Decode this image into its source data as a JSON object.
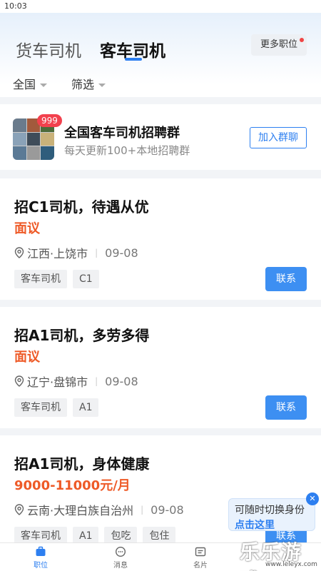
{
  "status_bar": {
    "time": "10:03"
  },
  "header": {
    "tabs": [
      "货车司机",
      "客车司机"
    ],
    "more_jobs": "更多职位",
    "filters": [
      "全国",
      "筛选"
    ]
  },
  "group": {
    "badge": "999",
    "title": "全国客车司机招聘群",
    "subtitle": "每天更新100+本地招聘群",
    "join": "加入群聊"
  },
  "jobs": [
    {
      "title": "招C1司机，待遇从优",
      "salary": "面议",
      "location": "江西·上饶市",
      "date": "09-08",
      "tags": [
        "客车司机",
        "C1"
      ],
      "contact": "联系"
    },
    {
      "title": "招A1司机，多劳多得",
      "salary": "面议",
      "location": "辽宁·盘锦市",
      "date": "09-08",
      "tags": [
        "客车司机",
        "A1"
      ],
      "contact": "联系"
    },
    {
      "title": "招A1司机，身体健康",
      "salary": "9000-11000元/月",
      "location": "云南·大理白族自治州",
      "date": "09-08",
      "tags": [
        "客车司机",
        "A1",
        "包吃",
        "包住"
      ],
      "contact": "联系"
    }
  ],
  "switch_tip": {
    "line1": "可随时切换身份",
    "line2": "点击这里",
    "close": "✕"
  },
  "bottom_nav": [
    {
      "label": "职位",
      "icon": "briefcase-icon"
    },
    {
      "label": "消息",
      "icon": "chat-icon"
    },
    {
      "label": "名片",
      "icon": "card-icon"
    }
  ],
  "watermark": {
    "text": "乐乐游戏",
    "url": "www.leleyx.com"
  },
  "colors": {
    "accent": "#2d7ff0",
    "salary": "#ee5a27",
    "badge": "#f2414e"
  }
}
